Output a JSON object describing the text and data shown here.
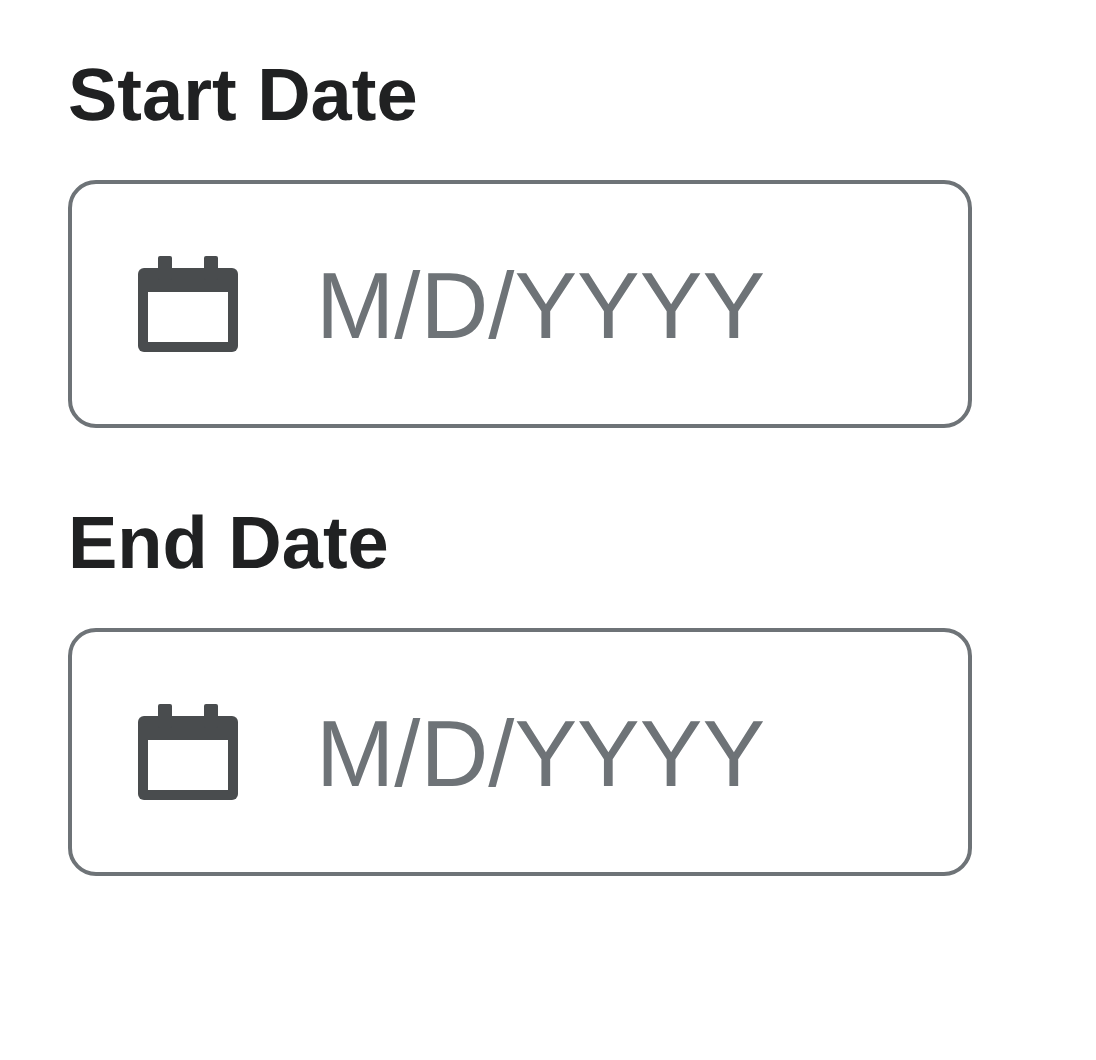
{
  "fields": [
    {
      "label": "Start Date",
      "placeholder": "M/D/YYYY"
    },
    {
      "label": "End Date",
      "placeholder": "M/D/YYYY"
    }
  ]
}
